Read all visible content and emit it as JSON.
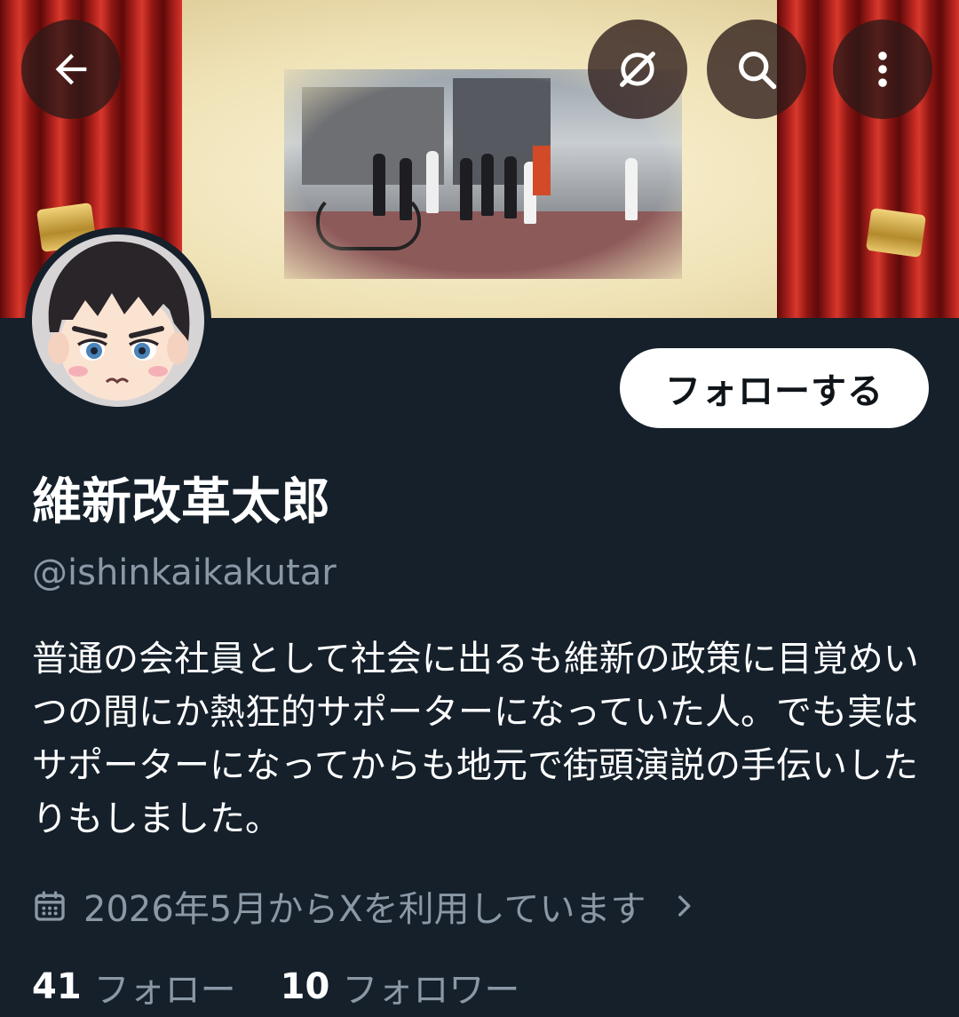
{
  "header": {
    "back_icon": "arrow-left-icon",
    "grok_icon": "grok-icon",
    "search_icon": "search-icon",
    "more_icon": "more-vertical-icon"
  },
  "profile": {
    "display_name": "維新改革太郎",
    "handle": "@ishinkaikakutar",
    "follow_label": "フォローする",
    "bio": "普通の会社員として社会に出るも維新の政策に目覚めいつの間にか熱狂的サポーターになっていた人。でも実はサポーターになってからも地元で街頭演説の手伝いしたりもしました。",
    "joined": "2026年5月からXを利用しています",
    "following_count": "41",
    "following_label": "フォロー",
    "followers_count": "10",
    "followers_label": "フォロワー"
  },
  "colors": {
    "background": "#15202b",
    "secondary_text": "#8b98a5",
    "follow_button_bg": "#ffffff",
    "follow_button_text": "#0f1419"
  }
}
